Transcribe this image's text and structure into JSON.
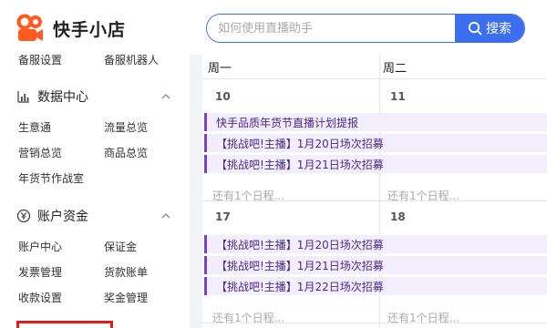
{
  "header": {
    "logo_text": "快手小店",
    "search_placeholder": "如何使用直播助手",
    "search_button": "搜索"
  },
  "sidebar": {
    "top_partial": [
      "备服设置",
      "备服机器人"
    ],
    "sections": [
      {
        "title": "数据中心",
        "icon": "chart-bar-icon",
        "items": [
          "生意通",
          "流量总览",
          "营销总览",
          "商品总览",
          "年货节作战室"
        ]
      },
      {
        "title": "账户资金",
        "icon": "yuan-circle-icon",
        "items": [
          "账户中心",
          "保证金",
          "发票管理",
          "货款账单",
          "收款设置",
          "奖金管理"
        ]
      }
    ]
  },
  "calendar": {
    "weekdays": [
      "周一",
      "周二"
    ],
    "weeks": [
      {
        "dates": [
          "10",
          "11"
        ],
        "events": [
          "快手品质年货节直播计划提报",
          "【挑战吧!主播】1月20日场次招募",
          "【挑战吧!主播】1月21日场次招募"
        ],
        "more": [
          "还有1个日程...",
          "还有1个日程..."
        ]
      },
      {
        "dates": [
          "17",
          "18"
        ],
        "events": [
          "【挑战吧!主播】1月20日场次招募",
          "【挑战吧!主播】1月21日场次招募",
          "【挑战吧!主播】1月22日场次招募"
        ],
        "more": [
          "还有1个日程...",
          "还有1个日程..."
        ]
      }
    ]
  },
  "colors": {
    "brand_orange": "#ff5a1f",
    "accent_blue": "#3b6ff0",
    "event_purple": "#7a3fd0",
    "highlight_red": "#e21b1b"
  }
}
